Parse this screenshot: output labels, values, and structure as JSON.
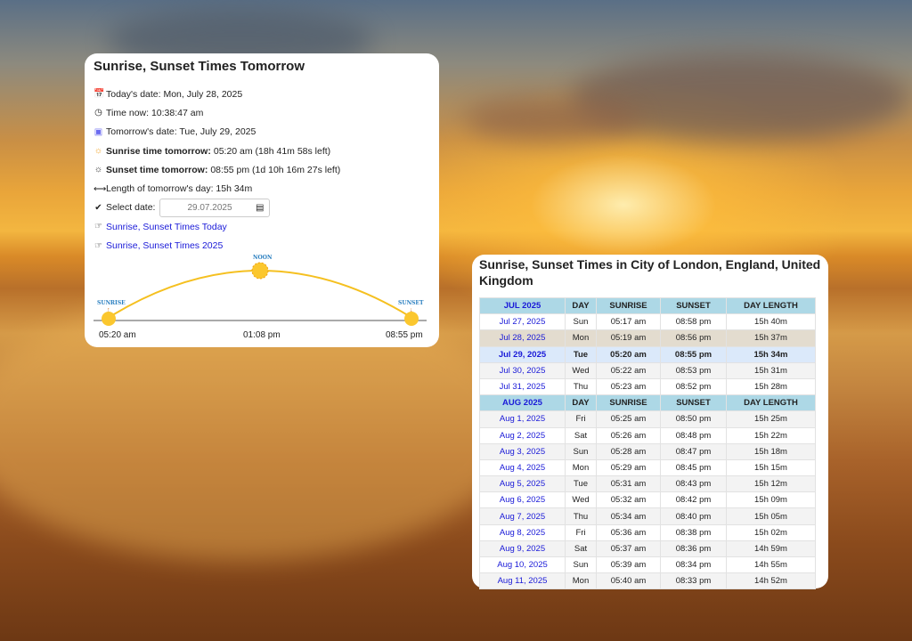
{
  "tomorrow_card": {
    "title": "Sunrise, Sunset Times Tomorrow",
    "today_date": "Today's date: Mon, July 28, 2025",
    "time_now": "Time now: 10:38:47 am",
    "tomorrow_date": "Tomorrow's date: Tue, July 29, 2025",
    "sunrise_label": "Sunrise time tomorrow:",
    "sunrise_value": "05:20 am (18h 41m 58s left)",
    "sunset_label": "Sunset time tomorrow:",
    "sunset_value": "08:55 pm (1d 10h 16m 27s left)",
    "day_length": "Length of tomorrow's day: 15h 34m",
    "select_date_label": "Select date:",
    "select_date_value": "29.07.2025",
    "link_today": "Sunrise, Sunset Times Today",
    "link_year": "Sunrise, Sunset Times 2025",
    "diagram": {
      "sunrise_tag": "SUNRISE",
      "noon_tag": "NOON",
      "sunset_tag": "SUNSET",
      "sunrise_time": "05:20 am",
      "noon_time": "01:08 pm",
      "sunset_time": "08:55 pm"
    }
  },
  "table_card": {
    "title": "Sunrise, Sunset Times in City of London, England, United Kingdom",
    "columns": [
      "DAY",
      "SUNRISE",
      "SUNSET",
      "DAY LENGTH"
    ],
    "months": [
      {
        "label": "JUL 2025",
        "rows": [
          [
            "Jul 27, 2025",
            "Sun",
            "05:17 am",
            "08:58 pm",
            "15h 40m"
          ],
          [
            "Jul 28, 2025",
            "Mon",
            "05:19 am",
            "08:56 pm",
            "15h 37m"
          ],
          [
            "Jul 29, 2025",
            "Tue",
            "05:20 am",
            "08:55 pm",
            "15h 34m"
          ],
          [
            "Jul 30, 2025",
            "Wed",
            "05:22 am",
            "08:53 pm",
            "15h 31m"
          ],
          [
            "Jul 31, 2025",
            "Thu",
            "05:23 am",
            "08:52 pm",
            "15h 28m"
          ]
        ]
      },
      {
        "label": "AUG 2025",
        "rows": [
          [
            "Aug 1, 2025",
            "Fri",
            "05:25 am",
            "08:50 pm",
            "15h 25m"
          ],
          [
            "Aug 2, 2025",
            "Sat",
            "05:26 am",
            "08:48 pm",
            "15h 22m"
          ],
          [
            "Aug 3, 2025",
            "Sun",
            "05:28 am",
            "08:47 pm",
            "15h 18m"
          ],
          [
            "Aug 4, 2025",
            "Mon",
            "05:29 am",
            "08:45 pm",
            "15h 15m"
          ],
          [
            "Aug 5, 2025",
            "Tue",
            "05:31 am",
            "08:43 pm",
            "15h 12m"
          ],
          [
            "Aug 6, 2025",
            "Wed",
            "05:32 am",
            "08:42 pm",
            "15h 09m"
          ],
          [
            "Aug 7, 2025",
            "Thu",
            "05:34 am",
            "08:40 pm",
            "15h 05m"
          ],
          [
            "Aug 8, 2025",
            "Fri",
            "05:36 am",
            "08:38 pm",
            "15h 02m"
          ],
          [
            "Aug 9, 2025",
            "Sat",
            "05:37 am",
            "08:36 pm",
            "14h 59m"
          ],
          [
            "Aug 10, 2025",
            "Sun",
            "05:39 am",
            "08:34 pm",
            "14h 55m"
          ],
          [
            "Aug 11, 2025",
            "Mon",
            "05:40 am",
            "08:33 pm",
            "14h 52m"
          ]
        ]
      }
    ],
    "today_row": "Jul 28, 2025",
    "selected_row": "Jul 29, 2025"
  }
}
